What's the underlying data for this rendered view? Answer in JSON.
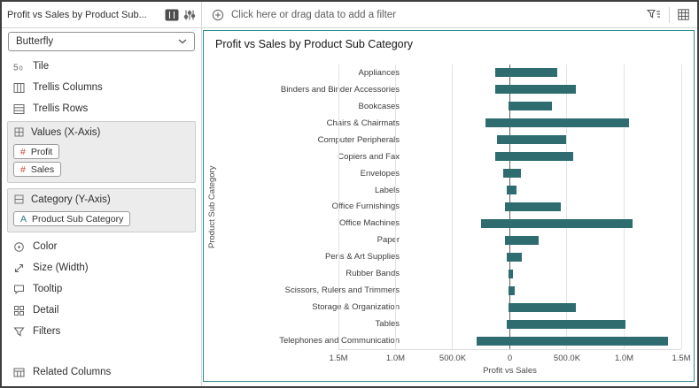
{
  "colors": {
    "bar": "#2e6c70",
    "selection_border": "#2e8c95",
    "measure_accent": "#c74634",
    "attribute_accent": "#2b7a8b"
  },
  "topbar": {
    "title": "Profit vs Sales by Product Sub...",
    "filter_bar_text": "Click here or drag data to add a filter"
  },
  "grammar_panel": {
    "viz_type": "Butterfly",
    "targets": [
      {
        "label": "Tile"
      },
      {
        "label": "Trellis Columns"
      },
      {
        "label": "Trellis Rows"
      }
    ],
    "values_section": {
      "label": "Values (X-Axis)",
      "pills": [
        {
          "prefix": "#",
          "label": "Profit"
        },
        {
          "prefix": "#",
          "label": "Sales"
        }
      ]
    },
    "category_section": {
      "label": "Category (Y-Axis)",
      "pills": [
        {
          "prefix": "A",
          "label": "Product Sub Category"
        }
      ]
    },
    "bottom_targets": [
      {
        "label": "Color"
      },
      {
        "label": "Size (Width)"
      },
      {
        "label": "Tooltip"
      },
      {
        "label": "Detail"
      },
      {
        "label": "Filters"
      }
    ],
    "related_columns": "Related Columns"
  },
  "chart_data": {
    "type": "bar",
    "variant": "butterfly",
    "title": "Profit vs Sales by Product Sub Category",
    "ylabel": "Product Sub Category",
    "xlabel": "Profit vs Sales",
    "axis_max": 1500000,
    "x_ticks": [
      "1.5M",
      "1.0M",
      "500.0K",
      "0",
      "500.0K",
      "1.0M",
      "1.5M"
    ],
    "grid": true,
    "legend": "none",
    "categories": [
      "Appliances",
      "Binders and Binder Accessories",
      "Bookcases",
      "Chairs & Chairmats",
      "Computer Peripherals",
      "Copiers and Fax",
      "Envelopes",
      "Labels",
      "Office Furnishings",
      "Office Machines",
      "Paper",
      "Pens & Art Supplies",
      "Rubber Bands",
      "Scissors, Rulers and Trimmers",
      "Storage & Organization",
      "Tables",
      "Telephones and Communication"
    ],
    "series": [
      {
        "name": "Profit",
        "side": "left",
        "values": [
          130000,
          125000,
          15000,
          215000,
          115000,
          130000,
          55000,
          25000,
          40000,
          255000,
          45000,
          25000,
          8000,
          10000,
          15000,
          30000,
          290000
        ]
      },
      {
        "name": "Sales",
        "side": "right",
        "values": [
          415000,
          580000,
          370000,
          1040000,
          490000,
          555000,
          100000,
          55000,
          445000,
          1075000,
          250000,
          105000,
          30000,
          45000,
          580000,
          1010000,
          1380000
        ]
      }
    ]
  }
}
